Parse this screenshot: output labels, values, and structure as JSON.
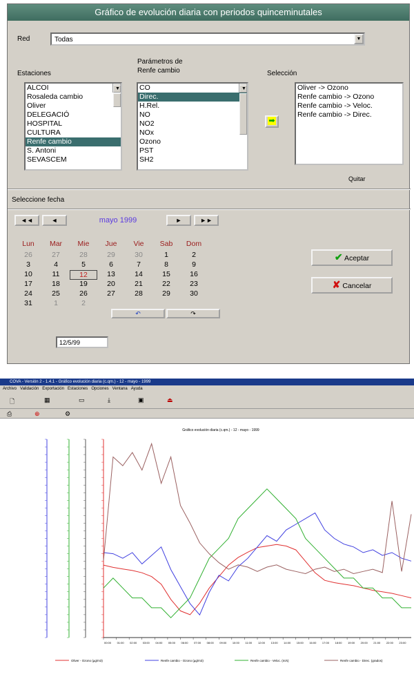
{
  "dialog": {
    "title": "Gráfico de evolución diaria con periodos quinceminutales",
    "red_label": "Red",
    "red_value": "Todas",
    "stations_label": "Estaciones",
    "params_label_1": "Parámetros de",
    "params_label_2": "Renfe cambio",
    "selection_label": "Selección",
    "stations": [
      "ALCOI",
      "Rosaleda cambio",
      "Oliver",
      "DELEGACIÓ",
      "HOSPITAL",
      "CULTURA",
      "Renfe cambio",
      "S. Antoni",
      "SEVASCEM"
    ],
    "stations_selected": "Renfe cambio",
    "parameters": [
      "CO",
      "Direc.",
      "H.Rel.",
      "NO",
      "NO2",
      "NOx",
      "Ozono",
      "PST",
      "SH2"
    ],
    "parameters_selected": "Direc.",
    "selection": [
      "Oliver -> Ozono",
      "Renfe cambio -> Ozono",
      "Renfe cambio -> Veloc.",
      "Renfe cambio -> Direc."
    ],
    "remove_label": "Quitar",
    "date_section_label": "Seleccione fecha",
    "accept_label": "Aceptar",
    "cancel_label": "Cancelar",
    "date_value": "12/5/99"
  },
  "calendar": {
    "nav_prev_year": "◄◄",
    "nav_prev_month": "◄",
    "nav_next_month": "►",
    "nav_next_year": "►►",
    "month": "mayo 1999",
    "weekdays": [
      "Lun",
      "Mar",
      "Mie",
      "Jue",
      "Vie",
      "Sab",
      "Dom"
    ],
    "weeks": [
      [
        "26",
        "27",
        "28",
        "29",
        "30",
        "1",
        "2"
      ],
      [
        "3",
        "4",
        "5",
        "6",
        "7",
        "8",
        "9"
      ],
      [
        "10",
        "11",
        "12",
        "13",
        "14",
        "15",
        "16"
      ],
      [
        "17",
        "18",
        "19",
        "20",
        "21",
        "22",
        "23"
      ],
      [
        "24",
        "25",
        "26",
        "27",
        "28",
        "29",
        "30"
      ],
      [
        "31",
        "1",
        "2"
      ]
    ],
    "selected_day": "12"
  },
  "app": {
    "title": "COVA - Versión 2 - 1.4.1 - Gráfico evolución diaria (c.qm.) - 12 - mayo - 1999",
    "menu": [
      "Archivo",
      "Validación",
      "Exportación",
      "Estaciones",
      "Opciones",
      "Ventana",
      "Ayuda"
    ]
  },
  "chart_data": {
    "type": "line",
    "title": "Gráfico evolución diaria (c.qm.) - 12 - mayo - 1999",
    "x_tick_labels": [
      "00:00",
      "01:00",
      "02:00",
      "03:00",
      "04:00",
      "05:00",
      "06:00",
      "07:00",
      "08:00",
      "09:00",
      "10:00",
      "11:00",
      "12:00",
      "13:00",
      "14:00",
      "15:00",
      "16:00",
      "17:00",
      "18:00",
      "19:00",
      "20:00",
      "21:00",
      "22:00",
      "23:00"
    ],
    "series": [
      {
        "name": "Oliver - Ozono (µg/m3)",
        "color": "#e03030",
        "values": [
          95,
          92,
          90,
          88,
          85,
          80,
          70,
          50,
          35,
          30,
          45,
          65,
          80,
          95,
          105,
          112,
          118,
          120,
          122,
          120,
          115,
          100,
          85,
          75,
          72,
          70,
          68,
          65,
          62,
          60,
          58,
          55,
          52
        ]
      },
      {
        "name": "Renfe cambio - Ozono (µg/m3)",
        "color": "#4040e0",
        "values": [
          150,
          148,
          140,
          150,
          130,
          145,
          160,
          120,
          90,
          60,
          40,
          80,
          110,
          100,
          125,
          140,
          160,
          180,
          170,
          190,
          200,
          210,
          220,
          190,
          175,
          165,
          160,
          150,
          155,
          145,
          150,
          140,
          135
        ]
      },
      {
        "name": "Renfe cambio - Veloc. (m/s)",
        "color": "#30b030",
        "values": [
          0.5,
          0.6,
          0.5,
          0.4,
          0.4,
          0.3,
          0.3,
          0.2,
          0.3,
          0.4,
          0.6,
          0.8,
          0.9,
          1.0,
          1.2,
          1.3,
          1.4,
          1.5,
          1.4,
          1.3,
          1.2,
          1.0,
          0.9,
          0.8,
          0.7,
          0.6,
          0.6,
          0.5,
          0.5,
          0.4,
          0.4,
          0.3,
          0.3
        ]
      },
      {
        "name": "Renfe cambio - Direc. (grados)",
        "color": "#9a6060",
        "values": [
          350,
          820,
          780,
          840,
          760,
          880,
          700,
          820,
          600,
          520,
          430,
          380,
          340,
          310,
          330,
          320,
          300,
          320,
          330,
          310,
          300,
          290,
          310,
          320,
          300,
          310,
          290,
          300,
          310,
          295,
          620,
          300,
          560
        ]
      }
    ]
  }
}
